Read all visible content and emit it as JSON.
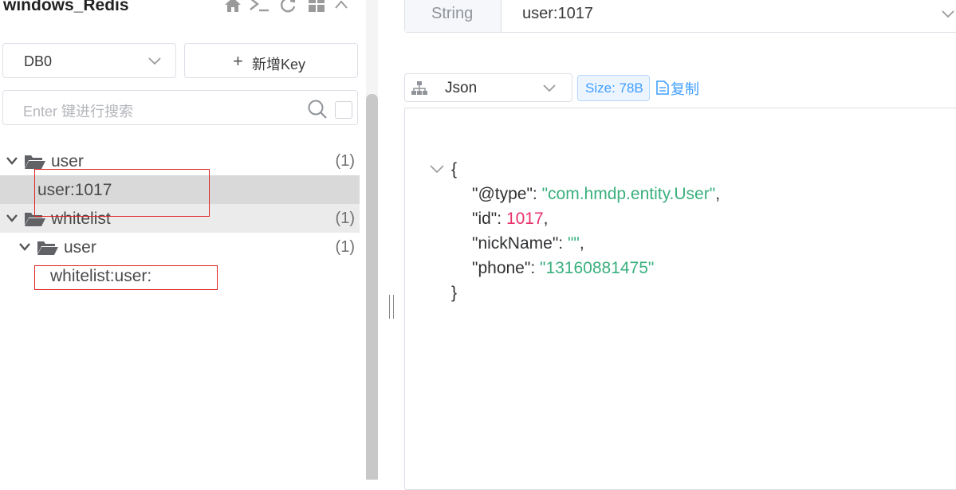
{
  "header": {
    "connection_name": "windows_Redis",
    "icons": [
      "home-icon",
      "terminal-icon",
      "refresh-icon",
      "grid-icon",
      "chevron-up-icon"
    ]
  },
  "left": {
    "db_select": {
      "value": "DB0"
    },
    "add_key": {
      "plus": "+",
      "label": "新增Key"
    },
    "search": {
      "placeholder": "Enter 键进行搜索"
    },
    "tree": [
      {
        "label": "user",
        "count": "(1)",
        "type": "folder",
        "expanded": true
      },
      {
        "label": "user:1017",
        "type": "key",
        "selected": true
      },
      {
        "label": "whitelist",
        "count": "(1)",
        "type": "folder",
        "expanded": true
      },
      {
        "label": "user",
        "count": "(1)",
        "type": "folder",
        "expanded": true
      },
      {
        "label": "whitelist:user:",
        "type": "key"
      }
    ]
  },
  "right": {
    "type_tag": "String",
    "key_name": "user:1017",
    "format": "Json",
    "size": "Size: 78B",
    "copy": "复制",
    "json": {
      "open": "{",
      "close": "}",
      "fields": [
        {
          "key": "\"@type\"",
          "value": "\"com.hmdp.entity.User\"",
          "kind": "string",
          "comma": ","
        },
        {
          "key": "\"id\"",
          "value": "1017",
          "kind": "number",
          "comma": ","
        },
        {
          "key": "\"nickName\"",
          "value": "\"\"",
          "kind": "string",
          "comma": ","
        },
        {
          "key": "\"phone\"",
          "value": "\"13160881475\"",
          "kind": "string",
          "comma": ""
        }
      ],
      "colon": ": "
    }
  },
  "colors": {
    "accent": "#409eff",
    "string": "#3ab07e",
    "number": "#e8326b",
    "highlight": "#e02020",
    "selected_row": "#d9d9d9"
  }
}
